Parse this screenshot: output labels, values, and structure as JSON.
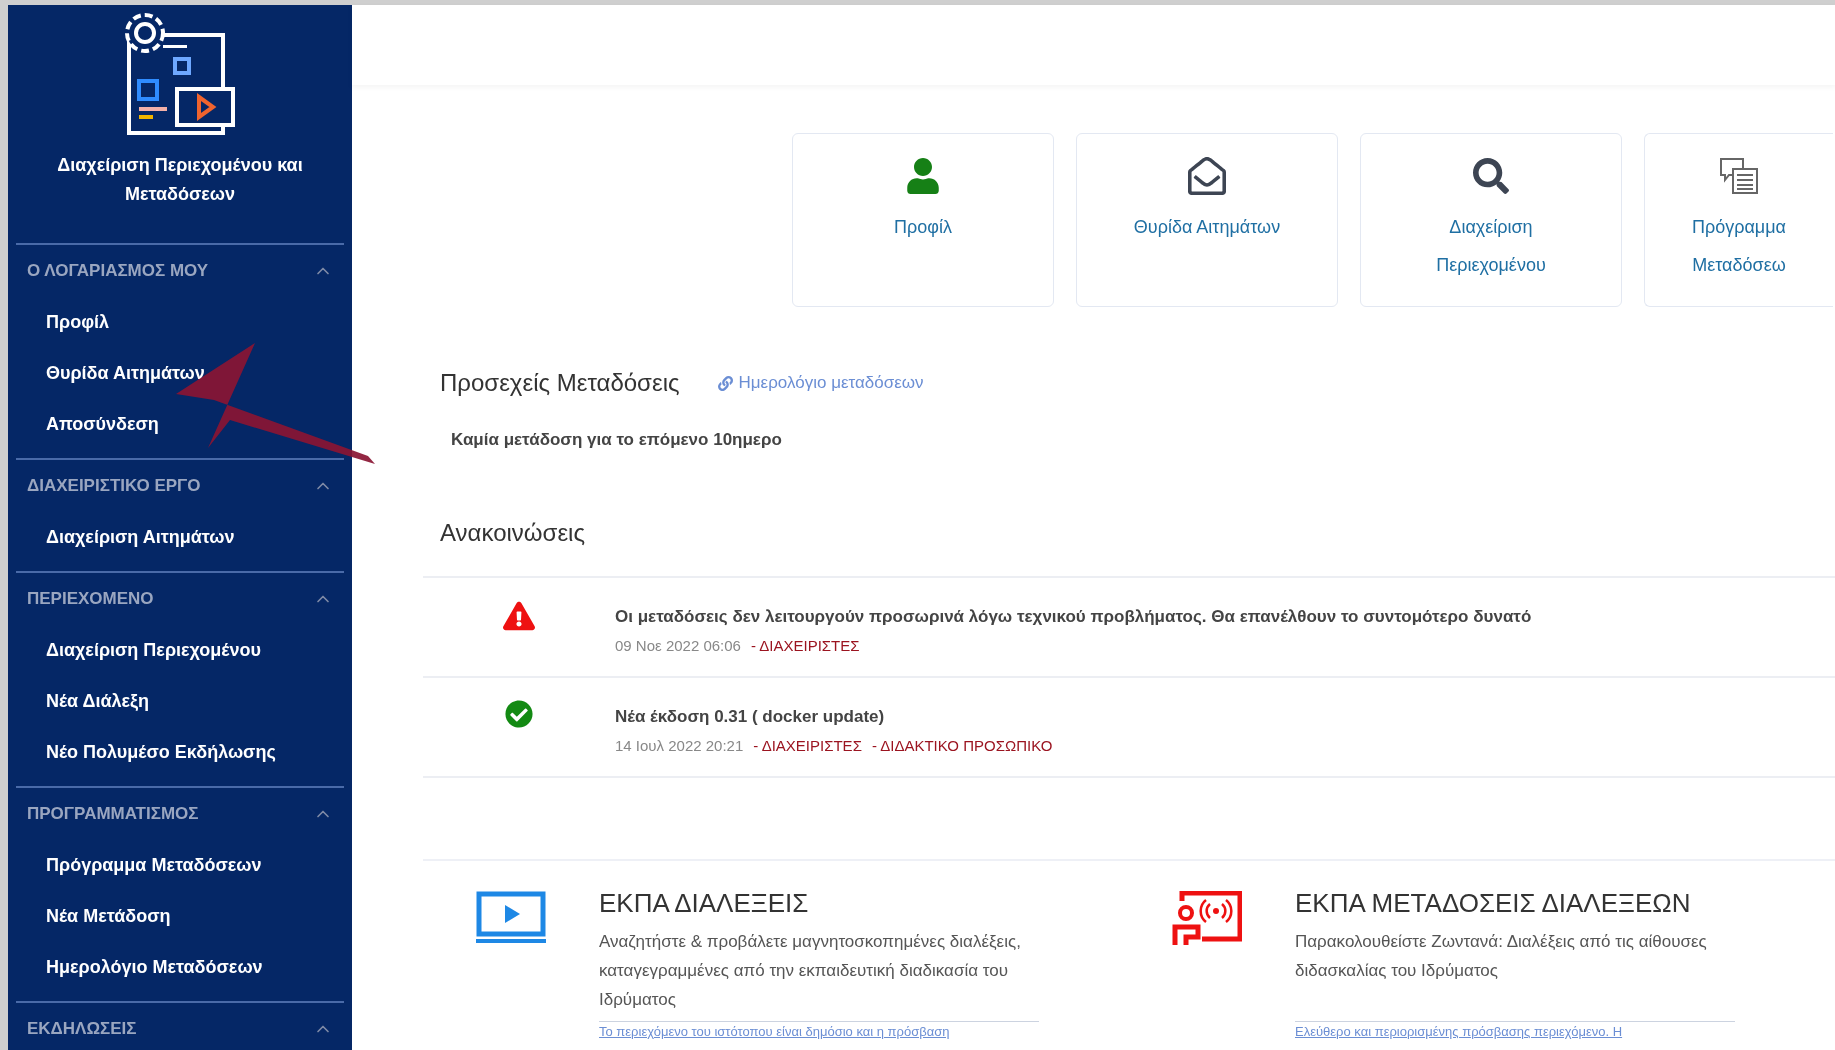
{
  "sidebar": {
    "logo_title": "Διαχείριση Περιεχομένου και Μεταδόσεων",
    "sections": [
      {
        "title": "Ο ΛΟΓΑΡΙΑΣΜΟΣ ΜΟΥ",
        "expanded": true,
        "items": [
          {
            "label": "Προφίλ"
          },
          {
            "label": "Θυρίδα Αιτημάτων"
          },
          {
            "label": "Αποσύνδεση"
          }
        ]
      },
      {
        "title": "ΔΙΑΧΕΙΡΙΣΤΙΚΟ ΕΡΓΟ",
        "expanded": true,
        "items": [
          {
            "label": "Διαχείριση Αιτημάτων"
          }
        ]
      },
      {
        "title": "ΠΕΡΙΕΧΟΜΕΝΟ",
        "expanded": true,
        "items": [
          {
            "label": "Διαχείριση Περιεχομένου"
          },
          {
            "label": "Νέα Διάλεξη"
          },
          {
            "label": "Νέο Πολυμέσο Εκδήλωσης"
          }
        ]
      },
      {
        "title": "ΠΡΟΓΡΑΜΜΑΤΙΣΜΟΣ",
        "expanded": true,
        "items": [
          {
            "label": "Πρόγραμμα Μεταδόσεων"
          },
          {
            "label": "Νέα Μετάδοση"
          },
          {
            "label": "Ημερολόγιο Μεταδόσεων"
          }
        ]
      },
      {
        "title": "ΕΚΔΗΛΩΣΕΙΣ",
        "expanded": true
      }
    ]
  },
  "cards": [
    {
      "kind": "user",
      "label": "Προφίλ"
    },
    {
      "kind": "envelope",
      "label": "Θυρίδα Αιτημάτων"
    },
    {
      "kind": "search",
      "label": "Διαχείριση Περιεχομένου"
    },
    {
      "kind": "chat",
      "label": "Πρόγραμμα Μεταδόσεω"
    }
  ],
  "upcoming": {
    "title": "Προσεχείς Μεταδόσεις",
    "link": "Ημερολόγιο μεταδόσεων",
    "message": "Καμία μετάδοση για το επόμενο 10ημερο"
  },
  "announcements": {
    "title": "Ανακοινώσεις",
    "items": [
      {
        "kind": "warning",
        "text": "Οι μεταδόσεις δεν λειτουργούν προσωρινά λόγω τεχνικού προβλήματος. Θα επανέλθουν το συντομότερο δυνατό",
        "date": "09 Νοε 2022 06:06",
        "tags": [
          "- ΔΙΑΧΕΙΡΙΣΤΕΣ"
        ]
      },
      {
        "kind": "success",
        "text": "Νέα έκδοση 0.31 ( docker update)",
        "date": "14 Ιουλ 2022 20:21",
        "tags": [
          "- ΔΙΑΧΕΙΡΙΣΤΕΣ",
          "- ΔΙΔΑΚΤΙΚΟ ΠΡΟΣΩΠΙΚΟ"
        ]
      }
    ]
  },
  "features": [
    {
      "kind": "video",
      "title": "ΕΚΠΑ ΔΙΑΛΕΞΕΙΣ",
      "description": "Αναζητήστε & προβάλετε μαγνητοσκοπημένες διαλέξεις, καταγεγραμμένες από την εκπαιδευτική διαδικασία του Ιδρύματος",
      "footer": "Το περιεχόμενο του ιστότοπου είναι δημόσιο και η πρόσβαση"
    },
    {
      "kind": "live",
      "title": "ΕΚΠΑ ΜΕΤΑΔΟΣΕΙΣ ΔΙΑΛΕΞΕΩΝ",
      "description": "Παρακολουθείστε Ζωντανά: Διαλέξεις από τις αίθουσες διδασκαλίας του Ιδρύματος",
      "footer": "Ελεύθερο και περιορισμένης πρόσβασης περιεχόμενο. Η"
    }
  ]
}
